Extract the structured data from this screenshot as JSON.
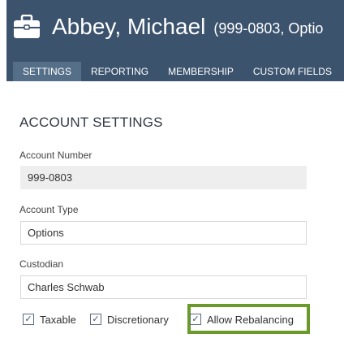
{
  "header": {
    "name": "Abbey, Michael",
    "subtitle": "(999-0803, Optio",
    "icon": "briefcase-icon"
  },
  "tabs": [
    {
      "label": "SETTINGS",
      "active": true
    },
    {
      "label": "REPORTING",
      "active": false
    },
    {
      "label": "MEMBERSHIP",
      "active": false
    },
    {
      "label": "CUSTOM FIELDS",
      "active": false
    }
  ],
  "account_settings": {
    "title": "ACCOUNT SETTINGS",
    "account_number": {
      "label": "Account Number",
      "value": "999-0803"
    },
    "account_type": {
      "label": "Account Type",
      "value": "Options"
    },
    "custodian": {
      "label": "Custodian",
      "value": "Charles Schwab"
    }
  },
  "checkboxes": [
    {
      "label": "Taxable",
      "checked": true
    },
    {
      "label": "Discretionary",
      "checked": true
    },
    {
      "label": "Allow Rebalancing",
      "checked": true
    }
  ],
  "colors": {
    "header_bg": "#3b536d",
    "active_tab_bg": "#566f89",
    "highlight": "#6a9a2a"
  }
}
